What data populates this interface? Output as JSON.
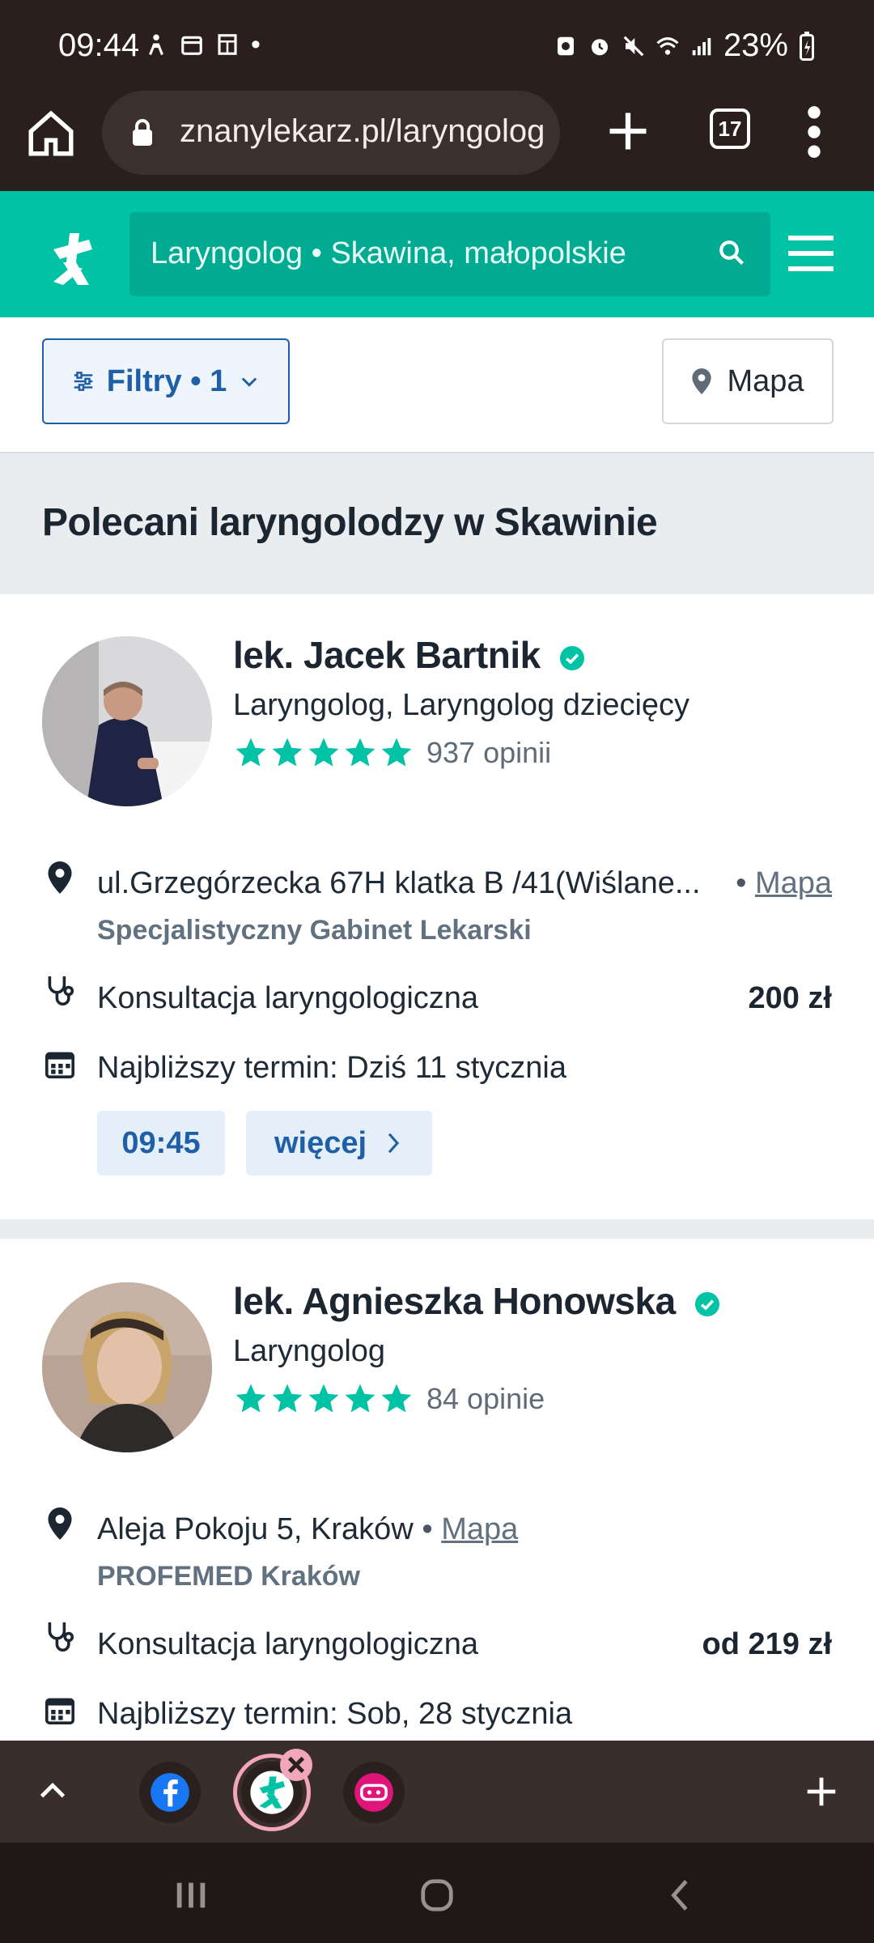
{
  "status_bar": {
    "time": "09:44",
    "battery": "23%",
    "dot": "•"
  },
  "browser": {
    "url": "znanylekarz.pl/laryngolog",
    "tab_count": "17"
  },
  "site": {
    "search_query": "Laryngolog • Skawina, małopolskie",
    "brand_color": "#00c3a5"
  },
  "filters": {
    "filters_label": "Filtry • 1",
    "map_label": "Mapa"
  },
  "section_title": "Polecani laryngolodzy w Skawinie",
  "doctors": [
    {
      "name": "lek. Jacek Bartnik",
      "specialty": "Laryngolog, Laryngolog dziecięcy",
      "rating_stars": 5,
      "opinions": "937 opinii",
      "address": "ul.Grzegórzecka 67H klatka B /41(Wiślane...",
      "address_sep": "•",
      "map_link": "Mapa",
      "facility": "Specjalistyczny Gabinet Lekarski",
      "service": "Konsultacja laryngologiczna",
      "price": "200 zł",
      "next_term": "Najbliższy termin: Dziś 11 stycznia",
      "slot_time": "09:45",
      "more_label": "więcej"
    },
    {
      "name": "lek. Agnieszka Honowska",
      "specialty": "Laryngolog",
      "rating_stars": 5,
      "opinions": "84 opinie",
      "address": "Aleja Pokoju 5, Kraków",
      "address_sep": "•",
      "map_link": "Mapa",
      "facility": "PROFEMED Kraków",
      "service": "Konsultacja laryngologiczna",
      "price": "od 219 zł",
      "next_term": "Najbliższy termin: Sob, 28 stycznia"
    }
  ],
  "tab_strip": {
    "tabs": [
      "facebook-tab",
      "znanylekarz-tab",
      "tooti-tab"
    ]
  }
}
